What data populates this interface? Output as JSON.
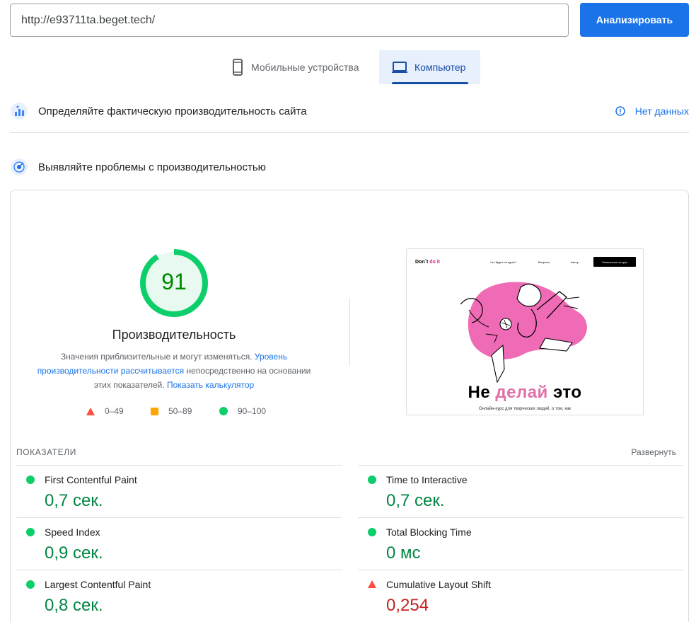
{
  "search": {
    "url": "http://e93711ta.beget.tech/",
    "analyze_label": "Анализировать"
  },
  "tabs": [
    {
      "label": "Мобильные устройства",
      "icon": "smartphone-icon",
      "active": false
    },
    {
      "label": "Компьютер",
      "icon": "laptop-icon",
      "active": true
    }
  ],
  "field_data": {
    "title": "Определяйте фактическую производительность сайта",
    "status": "Нет данных",
    "icon": "field-data-icon"
  },
  "lab_data": {
    "title": "Выявляйте проблемы с производительностью",
    "icon": "lab-data-icon"
  },
  "performance": {
    "score": "91",
    "score_fraction": 0.91,
    "label": "Производительность",
    "desc_1": "Значения приблизительные и могут изменяться.",
    "link_1": "Уровень производительности рассчитывается",
    "desc_2": "непосредственно на основании этих показателей.",
    "link_2": "Показать калькулятор",
    "colors": {
      "good": "#0cce6b",
      "good_bg": "#e8f9ef",
      "average": "#ffa400",
      "poor": "#ff4e42"
    }
  },
  "legend": [
    {
      "range": "0–49",
      "icon": "triangle-icon"
    },
    {
      "range": "50–89",
      "icon": "square-icon"
    },
    {
      "range": "90–100",
      "icon": "circle-icon"
    }
  ],
  "screenshot": {
    "logo_prefix": "Don`t ",
    "logo_accent": "do it",
    "nav": [
      "Что будет на курсе?",
      "Вопросы",
      "Автор"
    ],
    "button": "Записаться на курс",
    "heading_1": "Не ",
    "heading_accent": "делай",
    "heading_2": " это",
    "subtitle": "Онлайн-курс для творческих людей, о том, как"
  },
  "metrics_section": {
    "header": "ПОКАЗАТЕЛИ",
    "expand": "Развернуть"
  },
  "metrics": [
    {
      "name": "First Contentful Paint",
      "value": "0,7 сек.",
      "rating": "good"
    },
    {
      "name": "Time to Interactive",
      "value": "0,7 сек.",
      "rating": "good"
    },
    {
      "name": "Speed Index",
      "value": "0,9 сек.",
      "rating": "good"
    },
    {
      "name": "Total Blocking Time",
      "value": "0 мс",
      "rating": "good"
    },
    {
      "name": "Largest Contentful Paint",
      "value": "0,8 сек.",
      "rating": "good"
    },
    {
      "name": "Cumulative Layout Shift",
      "value": "0,254",
      "rating": "poor"
    }
  ]
}
